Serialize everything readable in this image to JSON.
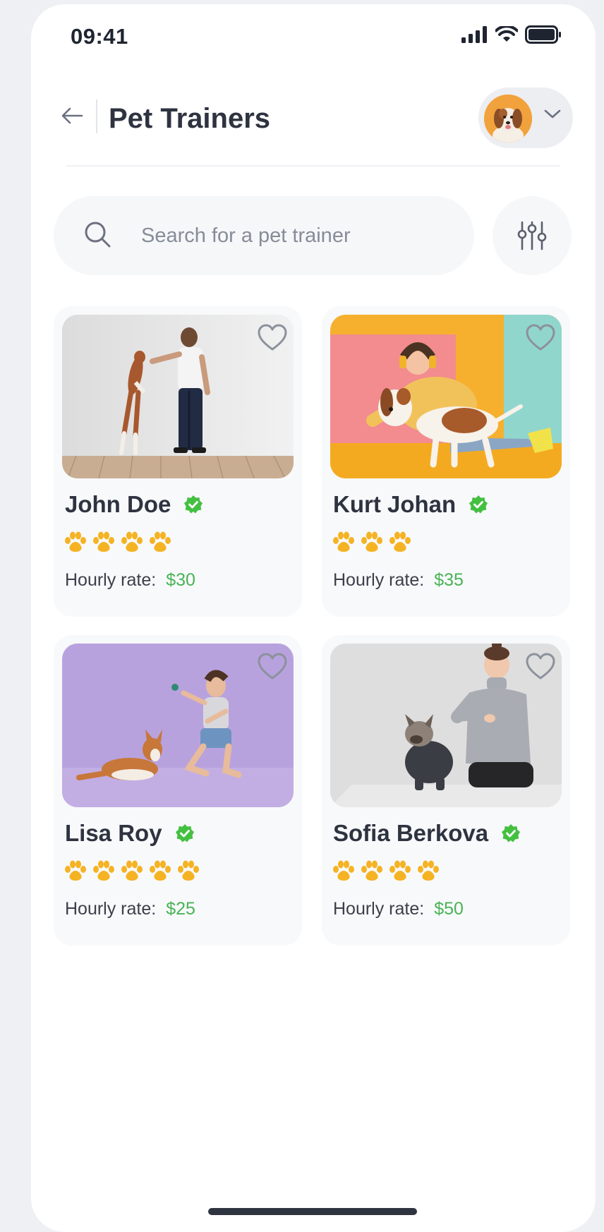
{
  "status_bar": {
    "time": "09:41"
  },
  "header": {
    "title": "Pet Trainers"
  },
  "search": {
    "placeholder": "Search for a pet trainer"
  },
  "colors": {
    "accent_green": "#49b357",
    "paw_yellow": "#f5b324",
    "verified_green": "#44c041"
  },
  "trainers": [
    {
      "name": "John Doe",
      "verified": true,
      "rating": 4,
      "rate_label": "Hourly rate:",
      "rate": "$30",
      "photo": "man-with-jumping-dog"
    },
    {
      "name": "Kurt Johan",
      "verified": true,
      "rating": 3,
      "rate_label": "Hourly rate:",
      "rate": "$35",
      "photo": "woman-hugging-beagle"
    },
    {
      "name": "Lisa Roy",
      "verified": true,
      "rating": 5,
      "rate_label": "Hourly rate:",
      "rate": "$25",
      "photo": "woman-playing-with-corgi"
    },
    {
      "name": "Sofia Berkova",
      "verified": true,
      "rating": 4,
      "rate_label": "Hourly rate:",
      "rate": "$50",
      "photo": "woman-with-french-bulldog"
    }
  ]
}
